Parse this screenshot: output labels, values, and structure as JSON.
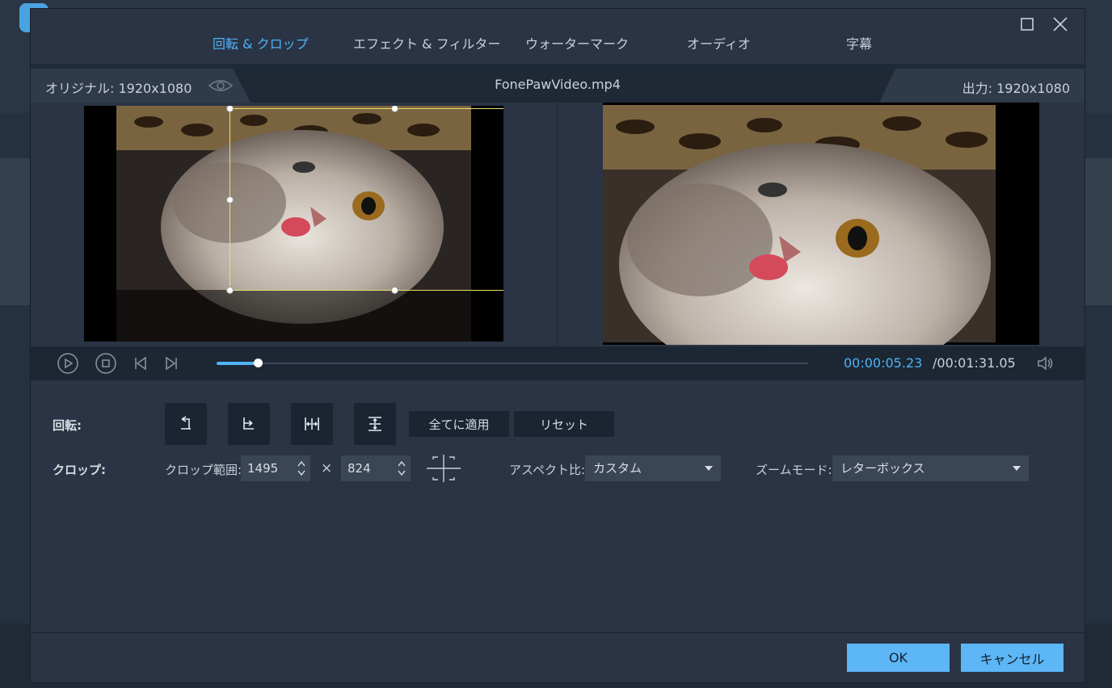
{
  "tabs": [
    {
      "label": "回転 & クロップ",
      "active": true
    },
    {
      "label": "エフェクト & フィルター",
      "active": false
    },
    {
      "label": "ウォーターマーク",
      "active": false
    },
    {
      "label": "オーディオ",
      "active": false
    },
    {
      "label": "字幕",
      "active": false
    }
  ],
  "preview": {
    "original_label": "オリジナル: 1920x1080",
    "file_name": "FonePawVideo.mp4",
    "output_label": "出力: 1920x1080"
  },
  "playback": {
    "progress_fraction": 0.07,
    "time_current": "00:00:05.23",
    "time_total": "/00:01:31.05"
  },
  "rotate": {
    "label": "回転:",
    "apply_all": "全てに適用",
    "reset": "リセット"
  },
  "crop": {
    "label": "クロップ:",
    "range_label": "クロップ範囲:",
    "width": "1495",
    "times": "×",
    "height": "824",
    "aspect_label": "アスペクト比:",
    "aspect_value": "カスタム",
    "zoom_label": "ズームモード:",
    "zoom_value": "レターボックス"
  },
  "footer": {
    "ok": "OK",
    "cancel": "キャンセル"
  },
  "colors": {
    "accent": "#4fb3f6",
    "crop_border": "#e8e36a",
    "primary_button": "#5db6f5"
  }
}
